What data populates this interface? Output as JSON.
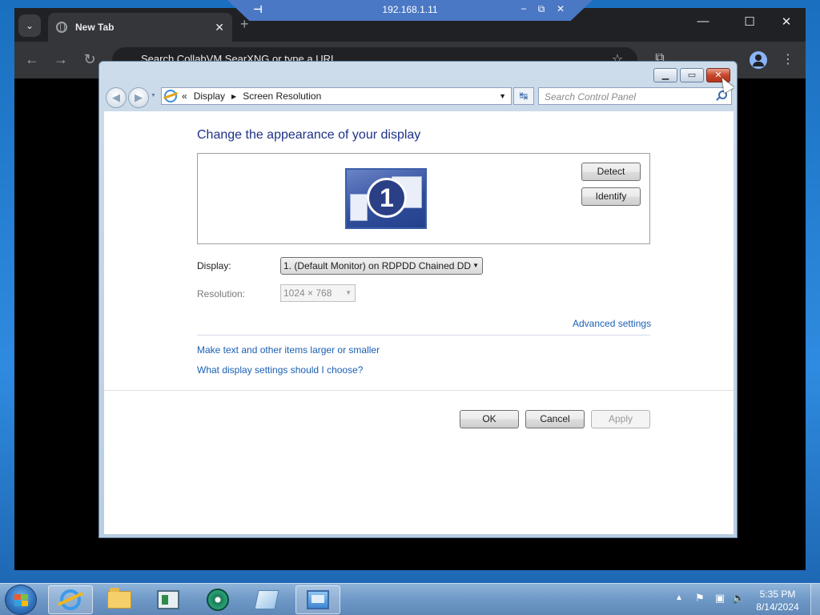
{
  "rdp": {
    "title": "192.168.1.11",
    "pin_glyph": "⊣",
    "minimize_glyph": "−",
    "restore_glyph": "⧉",
    "close_glyph": "✕"
  },
  "browser": {
    "tab_search_glyph": "⌄",
    "tab": {
      "title": "New Tab",
      "close_glyph": "✕"
    },
    "new_tab_glyph": "+",
    "window_controls": {
      "minimize": "—",
      "maximize": "☐",
      "close": "✕"
    },
    "omnibox": {
      "placeholder": "Search CollabVM SearXNG or type a URL"
    },
    "toolbar": {
      "back": "←",
      "forward": "→",
      "reload": "↻",
      "star": "☆",
      "extensions": "⧉",
      "menu": "⋮"
    }
  },
  "window": {
    "caption": {
      "minimize": "▁",
      "maximize": "▭",
      "close": "✕"
    },
    "nav": {
      "back": "◀",
      "forward": "▶",
      "history": "▼"
    },
    "breadcrumb": {
      "prefix": "«",
      "items": [
        "Display",
        "Screen Resolution"
      ],
      "separator": "▶",
      "dropdown": "▼"
    },
    "refresh_glyph": "↹",
    "search_placeholder": "Search Control Panel",
    "heading": "Change the appearance of your display",
    "monitor_number": "1",
    "buttons": {
      "detect": "Detect",
      "identify": "Identify",
      "ok": "OK",
      "cancel": "Cancel",
      "apply": "Apply"
    },
    "fields": {
      "display_label": "Display:",
      "display_value": "1. (Default Monitor) on RDPDD Chained DD",
      "resolution_label": "Resolution:",
      "resolution_value": "1024 × 768",
      "select_arrow": "▼"
    },
    "links": {
      "advanced": "Advanced settings",
      "text_size": "Make text and other items larger or smaller",
      "which_settings": "What display settings should I choose?"
    }
  },
  "taskbar": {
    "pinned": [
      "internet-explorer",
      "windows-explorer",
      "app-window",
      "media-player",
      "paper-app",
      "display-settings"
    ],
    "tray": {
      "expand": "▲",
      "flag": "⚑",
      "network": "▣",
      "volume": "🔈"
    },
    "clock": {
      "time": "5:35 PM",
      "date": "8/14/2024"
    }
  }
}
